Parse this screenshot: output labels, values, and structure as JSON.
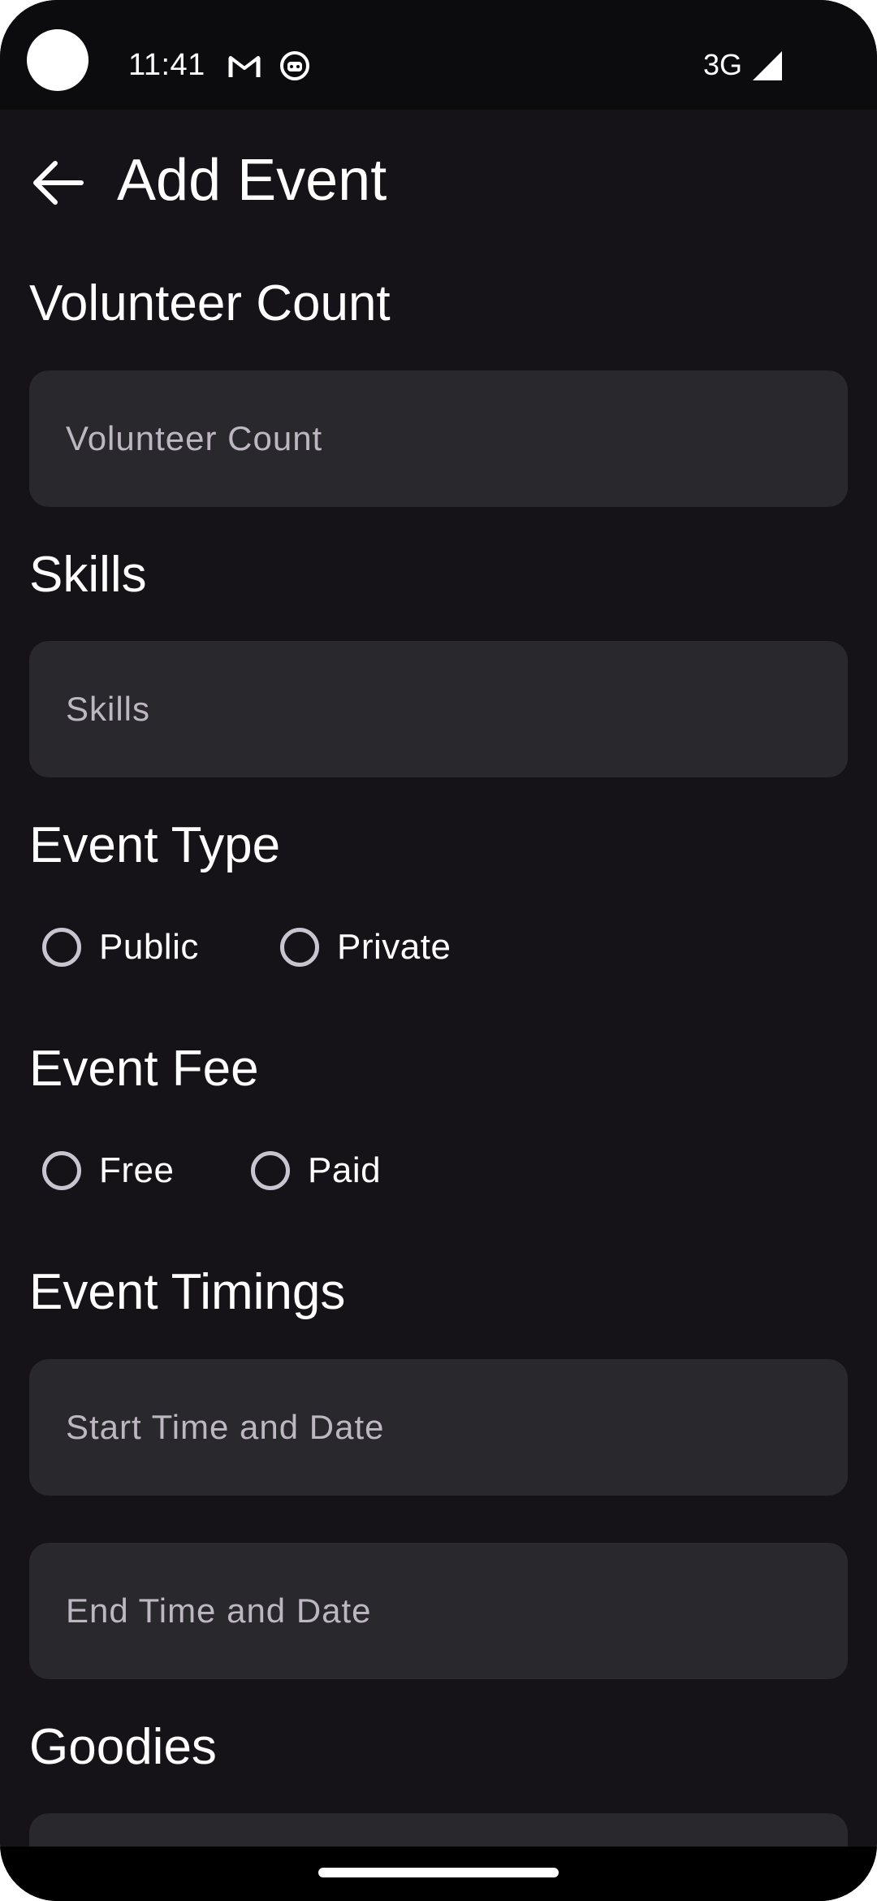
{
  "status_bar": {
    "time": "11:41",
    "network": "3G",
    "icons": [
      "gmail-icon",
      "bot-icon",
      "signal-icon"
    ]
  },
  "app_bar": {
    "title": "Add Event",
    "back_icon": "arrow-back-icon"
  },
  "form": {
    "volunteer_count": {
      "label": "Volunteer Count",
      "placeholder": "Volunteer Count",
      "value": ""
    },
    "skills": {
      "label": "Skills",
      "placeholder": "Skills",
      "value": ""
    },
    "event_type": {
      "label": "Event Type",
      "options": [
        "Public",
        "Private"
      ],
      "selected": null
    },
    "event_fee": {
      "label": "Event Fee",
      "options": [
        "Free",
        "Paid"
      ],
      "selected": null
    },
    "event_timings": {
      "label": "Event Timings",
      "start_placeholder": "Start Time and Date",
      "end_placeholder": "End Time and Date"
    },
    "goodies": {
      "label": "Goodies"
    }
  },
  "colors": {
    "background": "#151218",
    "field": "#29282d",
    "placeholder": "#bdb7c2",
    "radio_outline": "#cac4d0",
    "text": "#ffffff"
  }
}
